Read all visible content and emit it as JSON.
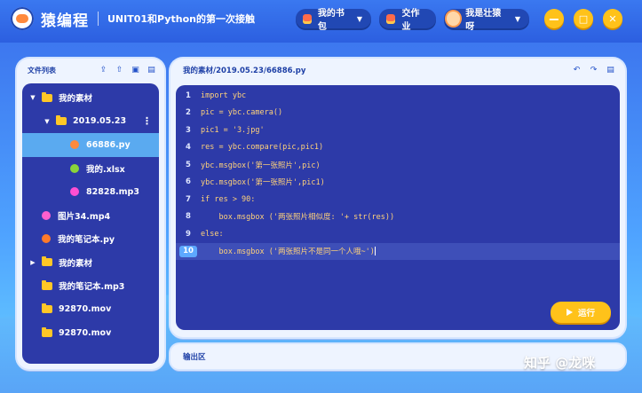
{
  "header": {
    "app_title": "猿编程",
    "lesson_title": "UNIT01和Python的第一次接触",
    "bookbag_label": "我的书包",
    "homework_label": "交作业",
    "user_label": "我是壮猿呀",
    "minimize": "−",
    "restore": "□",
    "close": "✕"
  },
  "file_panel": {
    "title": "文件列表",
    "items": [
      {
        "label": "我的素材",
        "type": "folder",
        "expanded": true,
        "indent": 0
      },
      {
        "label": "2019.05.23",
        "type": "folder",
        "expanded": true,
        "indent": 1
      },
      {
        "label": "66886.py",
        "type": "py",
        "active": true,
        "indent": 2
      },
      {
        "label": "我的.xlsx",
        "type": "xlsx",
        "indent": 2
      },
      {
        "label": "82828.mp3",
        "type": "mp3",
        "indent": 2
      },
      {
        "label": "图片34.mp4",
        "type": "mp4",
        "indent": 0
      },
      {
        "label": "我的笔记本.py",
        "type": "py2",
        "indent": 0
      },
      {
        "label": "我的素材",
        "type": "folder",
        "expanded": false,
        "indent": 0
      },
      {
        "label": "我的笔记本.mp3",
        "type": "folder",
        "indent": 0
      },
      {
        "label": "92870.mov",
        "type": "folder",
        "indent": 0
      },
      {
        "label": "92870.mov",
        "type": "folder",
        "indent": 0
      }
    ]
  },
  "editor": {
    "path": "我的素材/2019.05.23/66886.py",
    "lines": [
      {
        "n": "1",
        "code": "import ybc"
      },
      {
        "n": "2",
        "code": "pic = ybc.camera()"
      },
      {
        "n": "3",
        "code": "pic1 = '3.jpg'"
      },
      {
        "n": "4",
        "code": "res = ybc.compare(pic,pic1)"
      },
      {
        "n": "5",
        "code": "ybc.msgbox('第一张照片',pic)"
      },
      {
        "n": "6",
        "code": "ybc.msgbox('第一张照片',pic1)"
      },
      {
        "n": "7",
        "code": "if res > 90:"
      },
      {
        "n": "8",
        "code": "    box.msgbox ('两张照片相似度: '+ str(res))"
      },
      {
        "n": "9",
        "code": "else:"
      },
      {
        "n": "10",
        "code": "    box.msgbox ('两张照片不是同一个人哦~')",
        "current": true
      }
    ],
    "run_label": "运行"
  },
  "output": {
    "label": "输出区"
  },
  "watermark": "知乎 @龙咪",
  "colors": {
    "accent": "#ffc21a",
    "panel_dark": "#2d3aa8",
    "active_item": "#5aaaf0",
    "code_text": "#ffd27a"
  }
}
